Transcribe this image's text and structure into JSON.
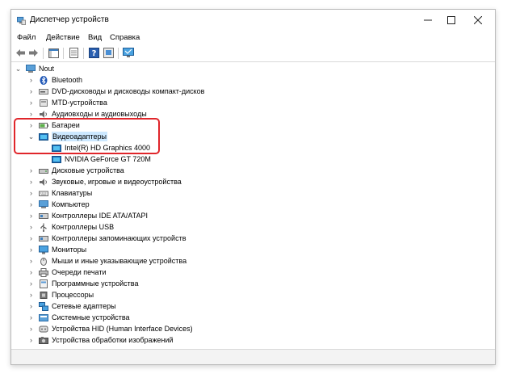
{
  "window": {
    "title": "Диспетчер устройств"
  },
  "menu": {
    "file": "Файл",
    "action": "Действие",
    "view": "Вид",
    "help": "Справка"
  },
  "tree": {
    "root": "Nout",
    "items": [
      "Bluetooth",
      "DVD-дисководы и дисководы компакт-дисков",
      "MTD-устройства",
      "Аудиовходы и аудиовыходы",
      "Батареи",
      "Видеоадаптеры",
      "Intel(R) HD Graphics 4000",
      "NVIDIA GeForce GT 720M",
      "Дисковые устройства",
      "Звуковые, игровые и видеоустройства",
      "Клавиатуры",
      "Компьютер",
      "Контроллеры IDE ATA/ATAPI",
      "Контроллеры USB",
      "Контроллеры запоминающих устройств",
      "Мониторы",
      "Мыши и иные указывающие устройства",
      "Очереди печати",
      "Программные устройства",
      "Процессоры",
      "Сетевые адаптеры",
      "Системные устройства",
      "Устройства HID (Human Interface Devices)",
      "Устройства обработки изображений"
    ]
  },
  "colors": {
    "highlight": "#e0262b",
    "selection": "#cce8ff"
  }
}
